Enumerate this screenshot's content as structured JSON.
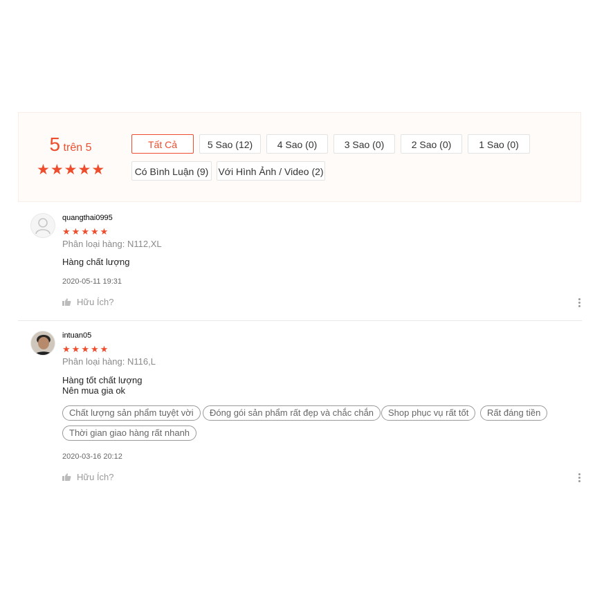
{
  "summary": {
    "score": "5",
    "out_of": "trên 5",
    "stars": 5
  },
  "filters": {
    "all": "Tất Cả",
    "five": "5 Sao (12)",
    "four": "4 Sao (0)",
    "three": "3 Sao (0)",
    "two": "2 Sao (0)",
    "one": "1 Sao (0)",
    "with_comment": "Có Bình Luận (9)",
    "with_media": "Với Hình Ảnh / Video (2)"
  },
  "reviews": [
    {
      "username": "quangthai0995",
      "stars": 5,
      "variant": "Phân loại hàng: N112,XL",
      "comment_lines": [
        "Hàng chất lượng"
      ],
      "tags": [],
      "time": "2020-05-11 19:31",
      "helpful": "Hữu Ích?"
    },
    {
      "username": "intuan05",
      "stars": 5,
      "variant": "Phân loại hàng: N116,L",
      "comment_lines": [
        "Hàng tốt chất lượng",
        "Nên mua gia ok"
      ],
      "tags": [
        "Chất lượng sản phẩm tuyệt vời",
        "Đóng gói sản phẩm rất đẹp và chắc chắn",
        "Shop phục vụ rất tốt",
        "Rất đáng tiền",
        "Thời gian giao hàng rất nhanh"
      ],
      "time": "2020-03-16 20:12",
      "helpful": "Hữu Ích?"
    }
  ],
  "colors": {
    "accent": "#ee4d2d",
    "summary_bg": "#fffbf8"
  }
}
